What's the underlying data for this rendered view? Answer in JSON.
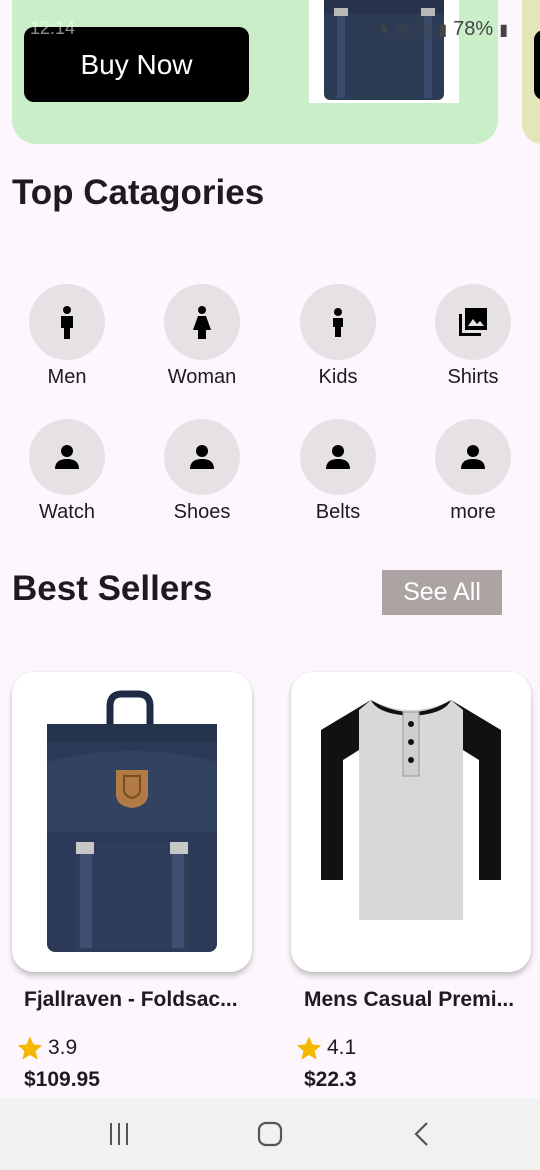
{
  "status_bar": {
    "time": "12:14",
    "battery": "78%",
    "icons": [
      "mute-icon",
      "hotspot-icon",
      "volte-icon",
      "signal-icon",
      "battery-icon"
    ]
  },
  "banner": {
    "button_label": "Buy Now",
    "background": "#c9eec8",
    "next_background": "#e3e6b7"
  },
  "top_categories": {
    "title": "Top Catagories",
    "items": [
      {
        "label": "Men",
        "icon": "man-icon"
      },
      {
        "label": "Woman",
        "icon": "woman-icon"
      },
      {
        "label": "Kids",
        "icon": "child-icon"
      },
      {
        "label": "Shirts",
        "icon": "photo-library-icon"
      },
      {
        "label": "Watch",
        "icon": "person-icon"
      },
      {
        "label": "Shoes",
        "icon": "person-icon"
      },
      {
        "label": "Belts",
        "icon": "person-icon"
      },
      {
        "label": "more",
        "icon": "person-icon"
      }
    ]
  },
  "best_sellers": {
    "title": "Best Sellers",
    "see_all_label": "See All",
    "products": [
      {
        "title": "Fjallraven - Foldsac...",
        "rating": "3.9",
        "price": "$109.95",
        "image": "backpack"
      },
      {
        "title": "Mens Casual Premi...",
        "rating": "4.1",
        "price": "$22.3",
        "image": "raglan-tshirt"
      }
    ]
  },
  "colors": {
    "background": "#fdf7fd",
    "category_circle": "#e6e1e5",
    "see_all_bg": "#aba4a3",
    "star": "#f5b800",
    "navbar": "#f1f1f1"
  }
}
